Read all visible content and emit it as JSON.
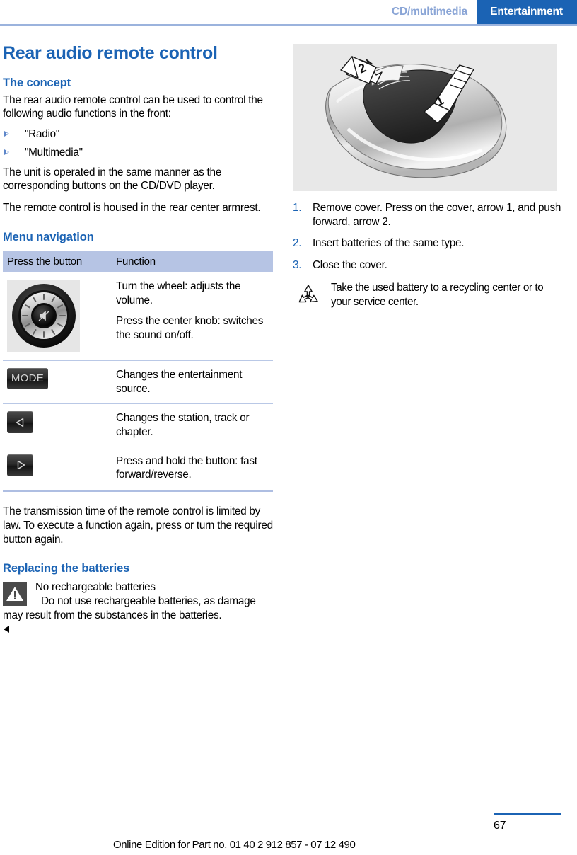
{
  "header": {
    "inactive_tab": "CD/multimedia",
    "active_tab": "Entertainment",
    "accent_color": "#1b63b4"
  },
  "left_column": {
    "title": "Rear audio remote control",
    "concept": {
      "heading": "The concept",
      "intro": "The rear audio remote control can be used to control the following audio functions in the front:",
      "bullets": [
        "\"Radio\"",
        "\"Multimedia\""
      ],
      "para_unit": "The unit is operated in the same manner as the corresponding buttons on the CD/DVD player.",
      "para_housed": "The remote control is housed in the rear center armrest."
    },
    "menu_navigation": {
      "heading": "Menu navigation",
      "columns": [
        "Press the button",
        "Function"
      ],
      "rows": [
        {
          "icon": "volume-knob-icon",
          "lines": [
            "Turn the wheel: adjusts the volume.",
            "Press the center knob: switches the sound on/off."
          ]
        },
        {
          "icon": "mode-button-icon",
          "button_label": "MODE",
          "lines": [
            "Changes the entertainment source."
          ]
        },
        {
          "icon": "left-arrow-button-icon",
          "lines": [
            "Changes the station, track or chapter."
          ]
        },
        {
          "icon": "right-arrow-button-icon",
          "lines": [
            "Press and hold the button: fast forward/reverse."
          ]
        }
      ],
      "after_table": "The transmission time of the remote control is limited by law. To execute a function again, press or turn the required button again."
    },
    "replacing_batteries": {
      "heading": "Replacing the batteries",
      "warning_title": "No rechargeable batteries",
      "warning_body": "Do not use rechargeable batteries, as damage may result from the substances in the batteries."
    }
  },
  "right_column": {
    "illustration_alt": "rear-audio-remote-control-battery-cover-illustration",
    "illustration_labels": [
      "1",
      "2"
    ],
    "steps": [
      {
        "num": "1.",
        "text": "Remove cover. Press on the cover, arrow 1, and push forward, arrow 2."
      },
      {
        "num": "2.",
        "text": "Insert batteries of the same type."
      },
      {
        "num": "3.",
        "text": "Close the cover."
      }
    ],
    "recycle_note": "Take the used battery to a recycling center or to your service center."
  },
  "footer": {
    "edition_note": "Online Edition for Part no. 01 40 2 912 857 - 07 12 490",
    "page_number": "67"
  }
}
